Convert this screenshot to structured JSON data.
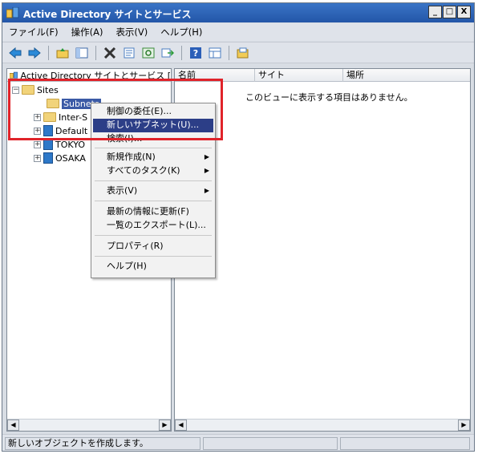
{
  "window": {
    "title": "Active Directory サイトとサービス",
    "minimize": "_",
    "maximize": "□",
    "close": "X"
  },
  "menubar": [
    "ファイル(F)",
    "操作(A)",
    "表示(V)",
    "ヘルプ(H)"
  ],
  "toolbar": {
    "buttons": [
      "back-arrow-icon",
      "forward-arrow-icon",
      "up-folder-icon",
      "show-tree-icon",
      "delete-icon",
      "properties-icon",
      "refresh-icon",
      "export-icon",
      "help-icon",
      "view-icon",
      "new-icon"
    ]
  },
  "tree": {
    "header": "Active Directory サイトとサービス [",
    "sites": "Sites",
    "subnets": "Subnets",
    "inter_site": "Inter-S",
    "default": "Default",
    "tokyo": "TOKYO",
    "osaka": "OSAKA",
    "expander_minus": "−",
    "expander_plus": "+"
  },
  "list": {
    "columns": [
      "名前",
      "サイト",
      "場所"
    ],
    "empty_message": "このビューに表示する項目はありません。"
  },
  "context_menu": {
    "items": [
      "制御の委任(E)...",
      "新しいサブネット(U)...",
      "検索(I)...",
      "新規作成(N)",
      "すべてのタスク(K)",
      "表示(V)",
      "最新の情報に更新(F)",
      "一覧のエクスポート(L)...",
      "プロパティ(R)",
      "ヘルプ(H)"
    ],
    "highlighted_index": 1
  },
  "statusbar": {
    "text": "新しいオブジェクトを作成します。"
  },
  "colors": {
    "title_bar": "#2356a8",
    "highlight": "#2c3e87",
    "annotation_box": "#e0232a"
  }
}
